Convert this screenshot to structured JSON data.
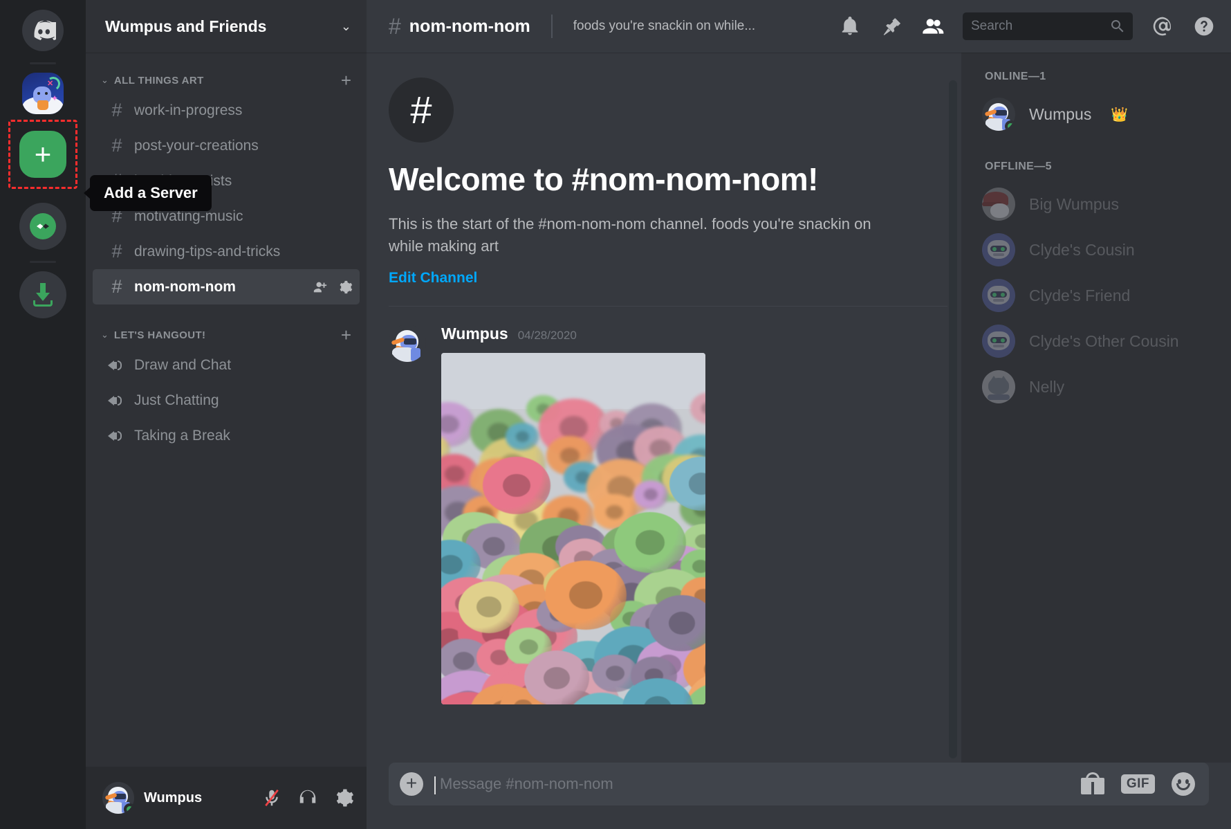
{
  "rail": {
    "home_icon": "discord-home-icon",
    "server_icon": "wumpus-and-friends-server-icon",
    "add_server_label": "+",
    "tooltip": "Add a Server",
    "explore_icon": "compass-explore-icon",
    "download_icon": "download-apps-icon"
  },
  "sidebar": {
    "server_name": "Wumpus and Friends",
    "categories": [
      {
        "name": "ALL THINGS ART",
        "type": "text",
        "channels": [
          {
            "name": "work-in-progress",
            "active": false
          },
          {
            "name": "post-your-creations",
            "active": false
          },
          {
            "name": "inspiring-artists",
            "active": false
          },
          {
            "name": "motivating-music",
            "active": false
          },
          {
            "name": "drawing-tips-and-tricks",
            "active": false
          },
          {
            "name": "nom-nom-nom",
            "active": true
          }
        ]
      },
      {
        "name": "LET'S HANGOUT!",
        "type": "voice",
        "channels": [
          {
            "name": "Draw and Chat",
            "active": false
          },
          {
            "name": "Just Chatting",
            "active": false
          },
          {
            "name": "Taking a Break",
            "active": false
          }
        ]
      }
    ],
    "user_panel": {
      "username": "Wumpus",
      "status": "online",
      "mic_icon": "microphone-muted-icon",
      "headphones_icon": "headphones-icon",
      "settings_icon": "user-settings-gear-icon"
    }
  },
  "header": {
    "hash": "#",
    "channel_name": "nom-nom-nom",
    "topic": "foods you're snackin on while...",
    "icons": [
      "notification-bell-icon",
      "pinned-messages-icon",
      "member-list-icon",
      "mention-icon",
      "help-icon"
    ],
    "search_placeholder": "Search"
  },
  "welcome": {
    "title": "Welcome to #nom-nom-nom!",
    "description": "This is the start of the #nom-nom-nom channel. foods you're snackin on while making art",
    "edit_link": "Edit Channel"
  },
  "message": {
    "author": "Wumpus",
    "timestamp": "04/28/2020",
    "attachment": "fruit-loops-cereal-photo"
  },
  "composer": {
    "placeholder": "Message #nom-nom-nom",
    "plus_label": "+",
    "gif_label": "GIF",
    "gift_icon": "gift-icon",
    "emoji_icon": "emoji-icon"
  },
  "members": {
    "online_header": "ONLINE—1",
    "offline_header": "OFFLINE—5",
    "online": [
      {
        "name": "Wumpus",
        "badge": "👑",
        "avatar": "wumpus"
      }
    ],
    "offline": [
      {
        "name": "Big Wumpus",
        "avatar": "bigwumpus"
      },
      {
        "name": "Clyde's Cousin",
        "avatar": "clyde"
      },
      {
        "name": "Clyde's Friend",
        "avatar": "clyde"
      },
      {
        "name": "Clyde's Other Cousin",
        "avatar": "clyde"
      },
      {
        "name": "Nelly",
        "avatar": "nelly"
      }
    ]
  },
  "colors": {
    "accent_green": "#3ba55d",
    "link_blue": "#00a8fc",
    "highlight_red": "#ff2d2d",
    "bg_main": "#36393f",
    "bg_sidebar": "#2f3136",
    "bg_rail": "#202225"
  }
}
